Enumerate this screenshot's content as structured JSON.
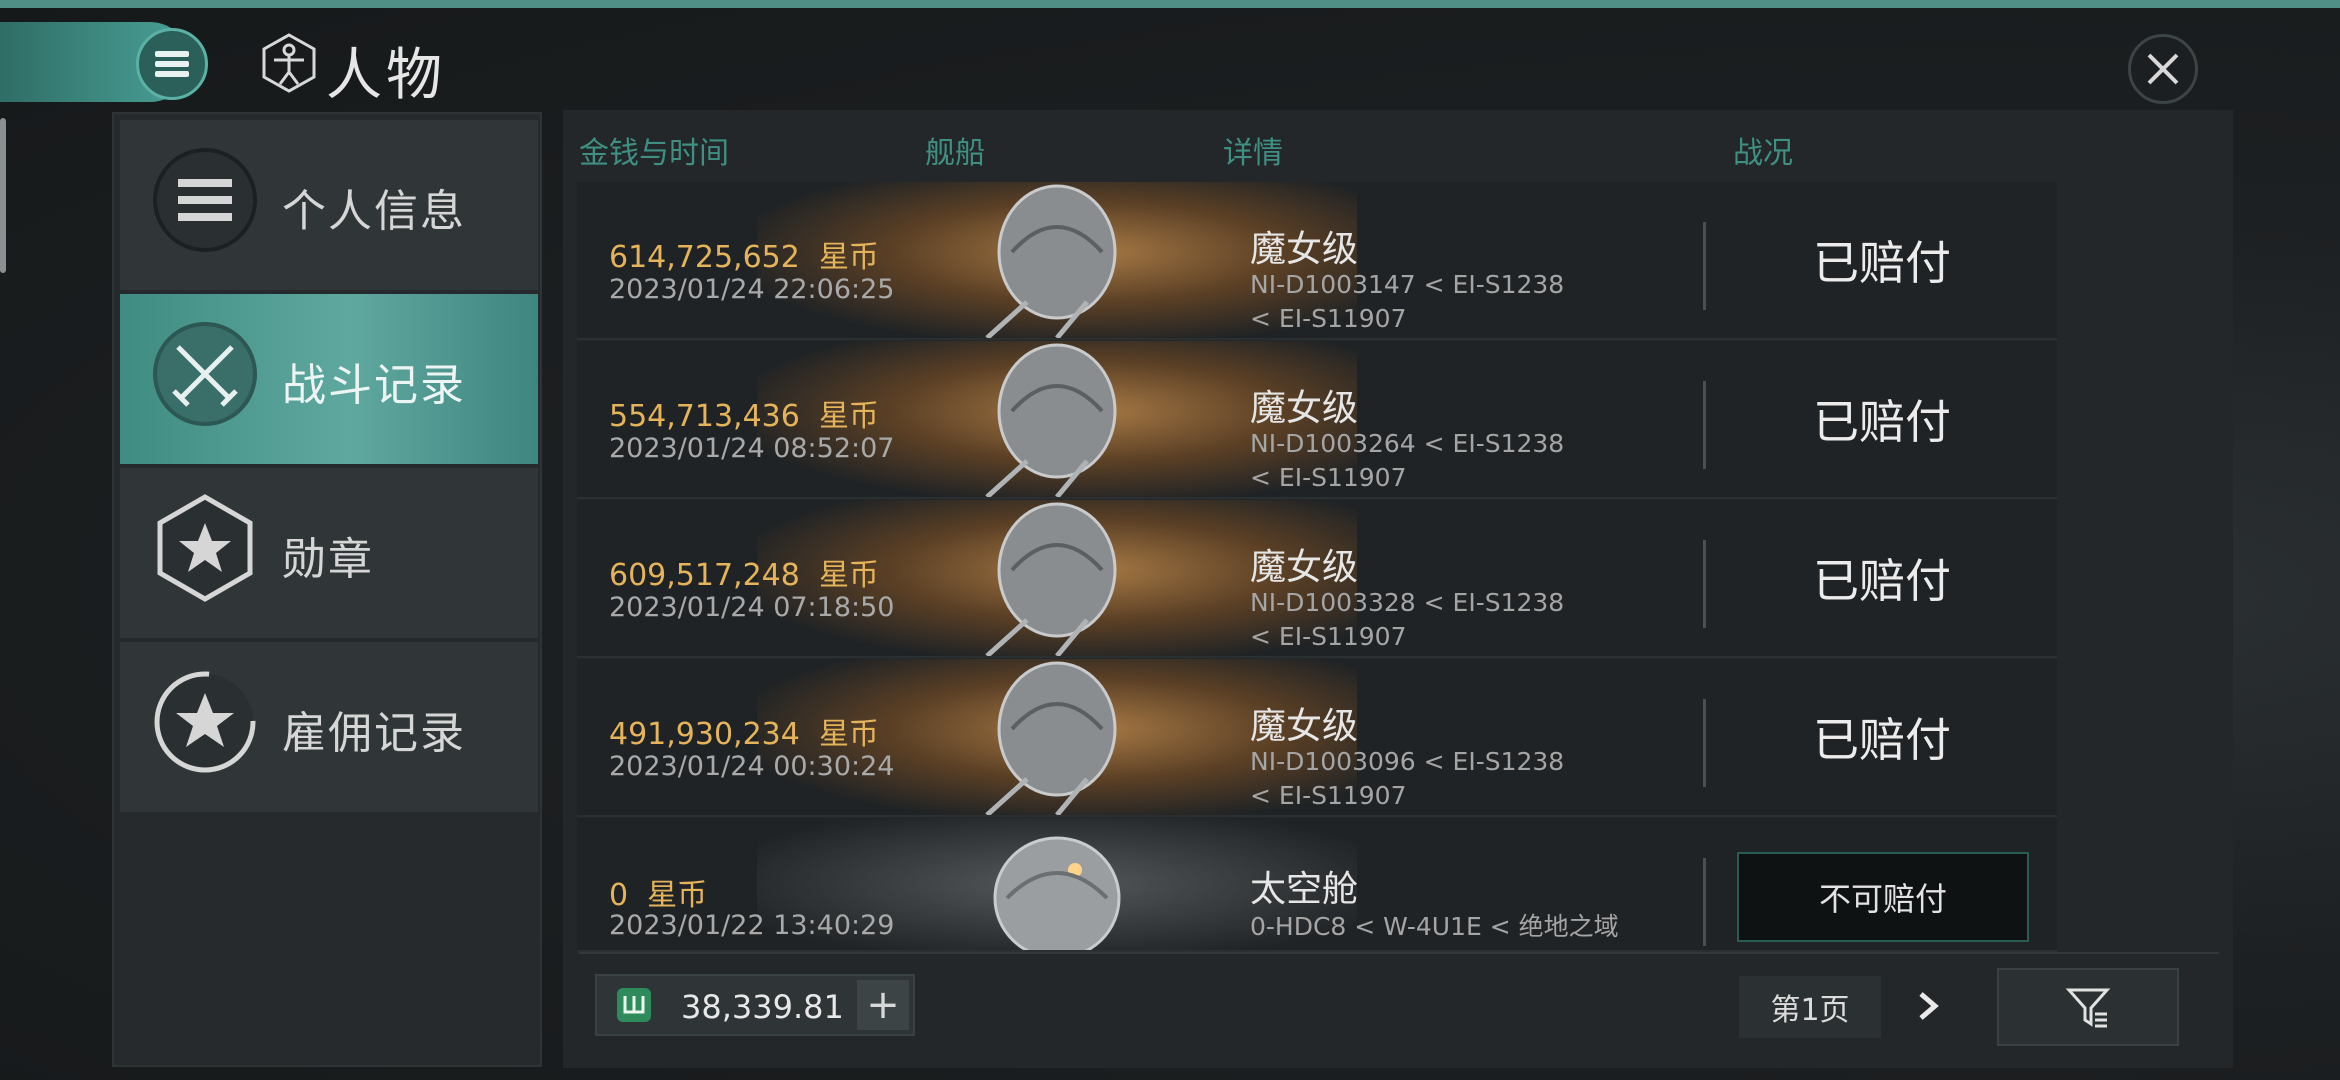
{
  "header": {
    "title": "人物"
  },
  "sidebar": {
    "items": [
      {
        "label": "个人信息",
        "icon": "list-icon"
      },
      {
        "label": "战斗记录",
        "icon": "crossed-swords-icon",
        "active": true
      },
      {
        "label": "勋章",
        "icon": "star-badge-icon"
      },
      {
        "label": "雇佣记录",
        "icon": "star-wreath-icon"
      }
    ]
  },
  "table": {
    "columns": [
      "金钱与时间",
      "舰船",
      "详情",
      "战况"
    ],
    "rows": [
      {
        "amount": "614,725,652",
        "currency": "星币",
        "time": "2023/01/24  22:06:25",
        "ship": "魔女级",
        "route": "NI-D1003147 < EI-S1238 < EI-S11907",
        "status": "已赔付"
      },
      {
        "amount": "554,713,436",
        "currency": "星币",
        "time": "2023/01/24  08:52:07",
        "ship": "魔女级",
        "route": "NI-D1003264 < EI-S1238 < EI-S11907",
        "status": "已赔付"
      },
      {
        "amount": "609,517,248",
        "currency": "星币",
        "time": "2023/01/24  07:18:50",
        "ship": "魔女级",
        "route": "NI-D1003328 < EI-S1238 < EI-S11907",
        "status": "已赔付"
      },
      {
        "amount": "491,930,234",
        "currency": "星币",
        "time": "2023/01/24  00:30:24",
        "ship": "魔女级",
        "route": "NI-D1003096 < EI-S1238 < EI-S11907",
        "status": "已赔付"
      },
      {
        "amount": "0",
        "currency": "星币",
        "time": "2023/01/22  13:40:29",
        "ship": "太空舱",
        "route": "0-HDC8 < W-4U1E < 绝地之域",
        "status": "不可赔付"
      }
    ]
  },
  "footer": {
    "wallet_value": "38,339.81",
    "wallet_plus": "+",
    "page_label": "第1页"
  },
  "colors": {
    "accent": "#4aa197",
    "money": "#e5b35a"
  }
}
